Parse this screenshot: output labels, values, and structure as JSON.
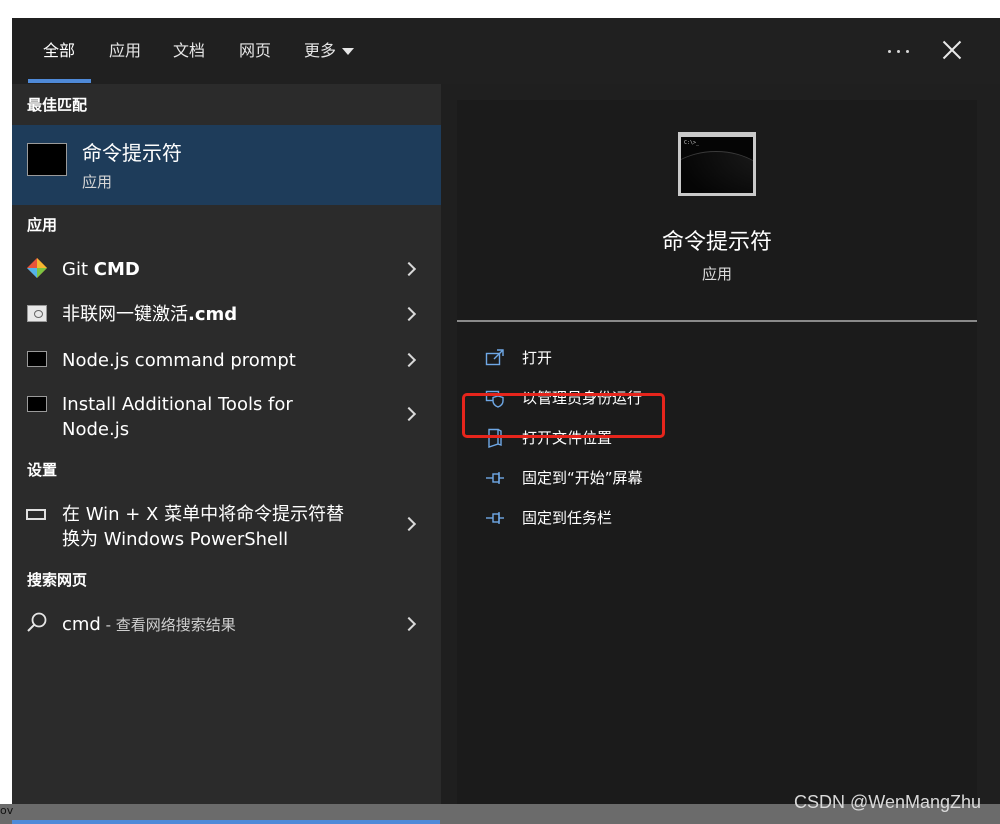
{
  "tabs": [
    {
      "label": "全部"
    },
    {
      "label": "应用"
    },
    {
      "label": "文档"
    },
    {
      "label": "网页"
    },
    {
      "label": "更多"
    }
  ],
  "left": {
    "best_match_header": "最佳匹配",
    "best_match": {
      "title": "命令提示符",
      "subtitle": "应用"
    },
    "apps_header": "应用",
    "apps": [
      {
        "name_plain": "Git ",
        "name_bold": "CMD"
      },
      {
        "name_plain": "非联网一键激活",
        "name_bold": ".cmd"
      },
      {
        "line1": "Node.js command prompt"
      },
      {
        "line1": "Install Additional Tools for",
        "line2": "Node.js"
      }
    ],
    "settings_header": "设置",
    "settings": [
      {
        "line1": "在 Win + X 菜单中将命令提示符替",
        "line2": "换为 Windows PowerShell"
      }
    ],
    "web_header": "搜索网页",
    "web": {
      "query": "cmd",
      "suffix": " - 查看网络搜索结果"
    }
  },
  "detail": {
    "prompt_text": "C:\\>_",
    "title": "命令提示符",
    "subtitle": "应用",
    "actions": [
      {
        "label": "打开",
        "icon": "open-icon"
      },
      {
        "label": "以管理员身份运行",
        "icon": "shield-icon"
      },
      {
        "label": "打开文件位置",
        "icon": "file-location-icon"
      },
      {
        "label": "固定到“开始”屏幕",
        "icon": "pin-icon"
      },
      {
        "label": "固定到任务栏",
        "icon": "pin-icon"
      }
    ]
  },
  "taskbar": {
    "fragment": "ov"
  },
  "watermark": "CSDN @WenMangZhu",
  "colors": {
    "accent": "#4f8ad8",
    "selection": "#1e3c5a",
    "highlight_box": "#e6251c"
  }
}
